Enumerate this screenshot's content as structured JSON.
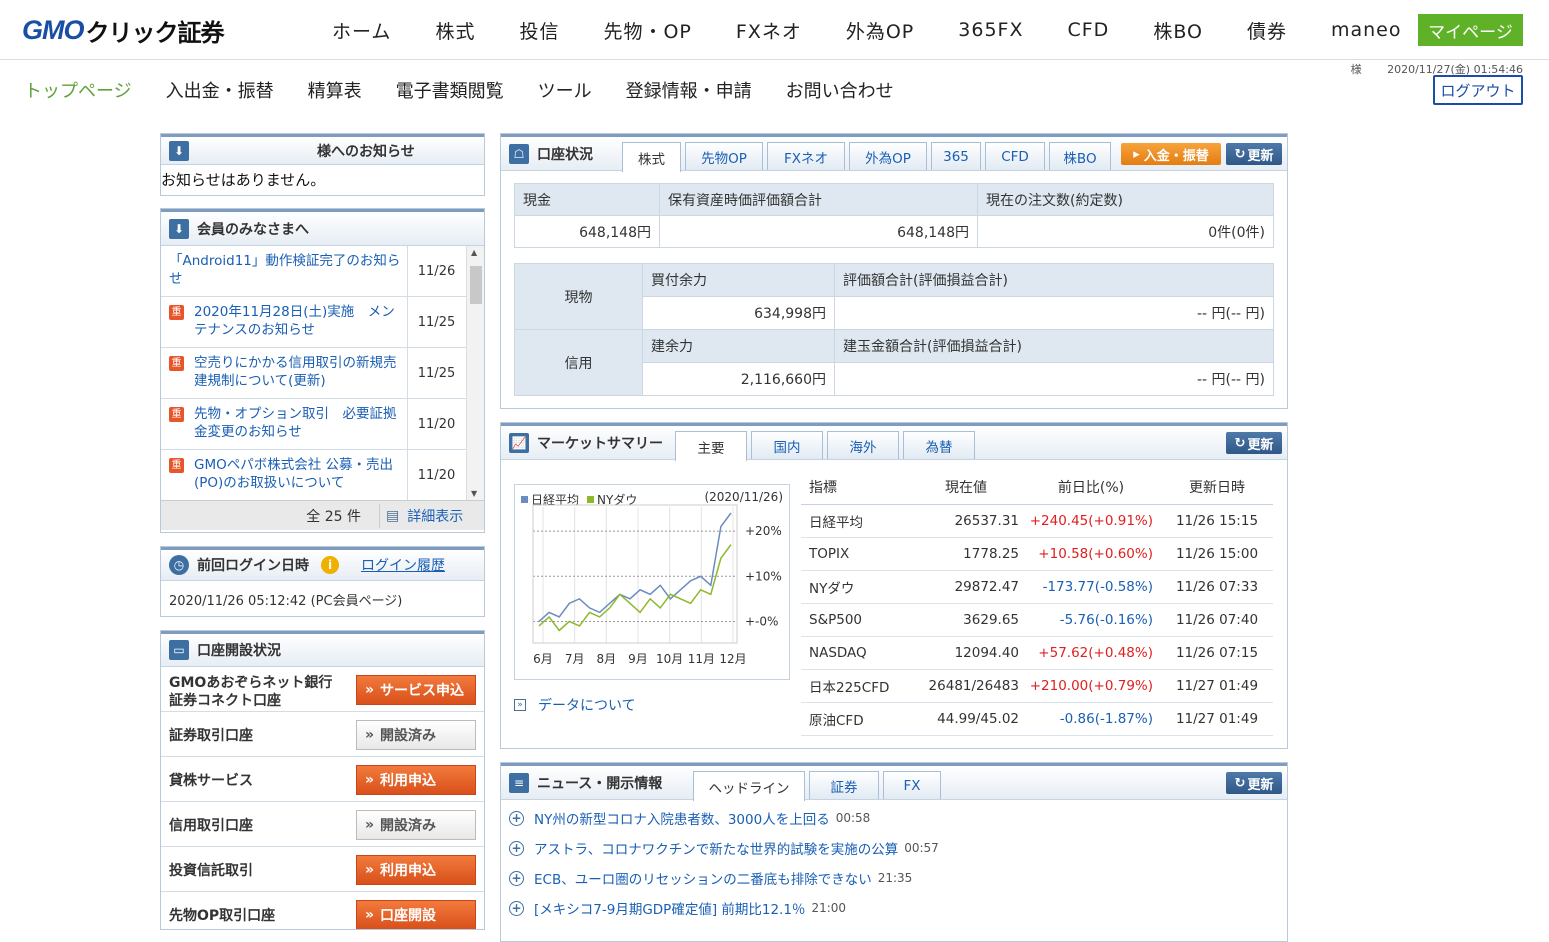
{
  "logo": {
    "brand": "GMO",
    "jp": "クリック証券"
  },
  "mainnav": [
    "ホーム",
    "株式",
    "投信",
    "先物・OP",
    "FXネオ",
    "外為OP",
    "365FX",
    "CFD",
    "株BO",
    "債券",
    "maneo"
  ],
  "mypage": "マイページ",
  "subnav": [
    "トップページ",
    "入出金・振替",
    "精算表",
    "電子書類閲覧",
    "ツール",
    "登録情報・申請",
    "お問い合わせ"
  ],
  "user": {
    "suffix": "様",
    "datetime": "2020/11/27(金) 01:54:46",
    "logout": "ログアウト"
  },
  "notice": {
    "title": "様へのお知らせ",
    "body": "お知らせはありません。"
  },
  "members": {
    "title": "会員のみなさまへ",
    "items": [
      {
        "text": "「Android11」動作検証完了のお知らせ",
        "date": "11/26",
        "important": false
      },
      {
        "text": "2020年11月28日(土)実施　メンテナンスのお知らせ",
        "date": "11/25",
        "important": true
      },
      {
        "text": "空売りにかかる信用取引の新規売建規制について(更新)",
        "date": "11/25",
        "important": true
      },
      {
        "text": "先物・オプション取引　必要証拠金変更のお知らせ",
        "date": "11/20",
        "important": true
      },
      {
        "text": "GMOペパボ株式会社 公募・売出(PO)のお取扱いについて",
        "date": "11/20",
        "important": true
      }
    ],
    "important_icon": "重",
    "total": "全 25 件",
    "detail": "詳細表示"
  },
  "lastlogin": {
    "title": "前回ログイン日時",
    "history": "ログイン履歴",
    "value": "2020/11/26 05:12:42 (PC会員ページ)"
  },
  "accounts": {
    "title": "口座開設状況",
    "rows": [
      {
        "label": "GMOあおぞらネット銀行\n証券コネクト口座",
        "button": "サービス申込",
        "state": "apply"
      },
      {
        "label": "証券取引口座",
        "button": "開設済み",
        "state": "done"
      },
      {
        "label": "貸株サービス",
        "button": "利用申込",
        "state": "apply"
      },
      {
        "label": "信用取引口座",
        "button": "開設済み",
        "state": "done"
      },
      {
        "label": "投資信託取引",
        "button": "利用申込",
        "state": "apply"
      },
      {
        "label": "先物OP取引口座",
        "button": "口座開設",
        "state": "apply"
      }
    ]
  },
  "status": {
    "title": "口座状況",
    "tabs": [
      "株式",
      "先物OP",
      "FXネオ",
      "外為OP",
      "365",
      "CFD",
      "株BO"
    ],
    "deposit": "入金・振替",
    "update": "更新",
    "summary": {
      "headers": [
        "現金",
        "保有資産時価評価額合計",
        "現在の注文数(約定数)"
      ],
      "values": [
        "648,148円",
        "648,148円",
        "0件(0件)"
      ]
    },
    "genbutsu": {
      "label": "現物",
      "h1": "買付余力",
      "h2": "評価額合計(評価損益合計)",
      "v1": "634,998円",
      "v2": "-- 円(-- 円)"
    },
    "shinyo": {
      "label": "信用",
      "h1": "建余力",
      "h2": "建玉金額合計(評価損益合計)",
      "v1": "2,116,660円",
      "v2": "-- 円(-- 円)"
    }
  },
  "market": {
    "title": "マーケットサマリー",
    "tabs": [
      "主要",
      "国内",
      "海外",
      "為替"
    ],
    "update": "更新",
    "about": "データについて",
    "headers": [
      "指標",
      "現在値",
      "前日比(%)",
      "更新日時"
    ],
    "rows": [
      {
        "name": "日経平均",
        "value": "26537.31",
        "change": "+240.45(+0.91%)",
        "dir": "up",
        "time": "11/26 15:15"
      },
      {
        "name": "TOPIX",
        "value": "1778.25",
        "change": "+10.58(+0.60%)",
        "dir": "up",
        "time": "11/26 15:00"
      },
      {
        "name": "NYダウ",
        "value": "29872.47",
        "change": "-173.77(-0.58%)",
        "dir": "dn",
        "time": "11/26 07:33"
      },
      {
        "name": "S&P500",
        "value": "3629.65",
        "change": "-5.76(-0.16%)",
        "dir": "dn",
        "time": "11/26 07:40"
      },
      {
        "name": "NASDAQ",
        "value": "12094.40",
        "change": "+57.62(+0.48%)",
        "dir": "up",
        "time": "11/26 07:15"
      },
      {
        "name": "日本225CFD",
        "value": "26481/26483",
        "change": "+210.00(+0.79%)",
        "dir": "up",
        "time": "11/27 01:49"
      },
      {
        "name": "原油CFD",
        "value": "44.99/45.02",
        "change": "-0.86(-1.87%)",
        "dir": "dn",
        "time": "11/27 01:49"
      }
    ]
  },
  "chart_data": {
    "type": "line",
    "date": "(2020/11/26)",
    "legend_position": "top-left",
    "x": [
      "6月",
      "7月",
      "8月",
      "9月",
      "10月",
      "11月",
      "12月"
    ],
    "y_ticks": [
      "+20%",
      "+10%",
      "+-0%"
    ],
    "ylim": [
      -3,
      24
    ],
    "series": [
      {
        "name": "日経平均",
        "color": "#6b8cc0",
        "values": [
          0,
          2,
          1,
          4,
          5,
          3,
          2,
          4,
          6,
          5,
          7,
          6,
          8,
          5,
          7,
          9,
          10,
          8,
          21,
          24
        ]
      },
      {
        "name": "NYダウ",
        "color": "#8db82a",
        "values": [
          -1,
          1,
          -2,
          0,
          -1,
          2,
          1,
          3,
          6,
          4,
          2,
          5,
          3,
          6,
          5,
          4,
          7,
          6,
          14,
          17
        ]
      }
    ]
  },
  "newspanel": {
    "title": "ニュース・開示情報",
    "tabs": [
      "ヘッドライン",
      "証券",
      "FX"
    ],
    "update": "更新",
    "items": [
      {
        "text": "NY州の新型コロナ入院患者数、3000人を上回る",
        "time": "00:58"
      },
      {
        "text": "アストラ、コロナワクチンで新たな世界的試験を実施の公算",
        "time": "00:57"
      },
      {
        "text": "ECB、ユーロ圏のリセッションの二番底も排除できない",
        "time": "21:35"
      },
      {
        "text": "[メキシコ7-9月期GDP確定値] 前期比12.1％",
        "time": "21:00"
      }
    ]
  }
}
